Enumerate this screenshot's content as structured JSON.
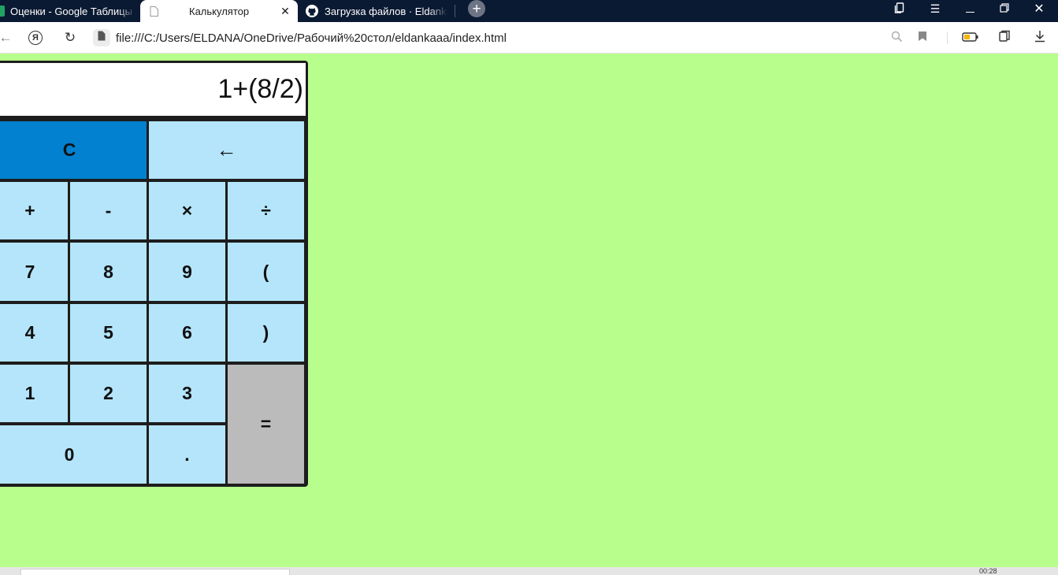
{
  "browser": {
    "tabs": [
      {
        "title": "Оценки - Google Таблицы",
        "icon": "google-sheets-icon",
        "active": false
      },
      {
        "title": "Калькулятор",
        "icon": "file-icon",
        "active": true
      },
      {
        "title": "Загрузка файлов · Eldanka",
        "icon": "github-icon",
        "active": false
      }
    ],
    "url": "file:///C:/Users/ELDANA/OneDrive/Рабочий%20стол/eldankaaa/index.html"
  },
  "calculator": {
    "display": "1+(8/2)",
    "keys": {
      "clear": "C",
      "backspace": "←",
      "plus": "+",
      "minus": "-",
      "multiply": "×",
      "divide": "÷",
      "seven": "7",
      "eight": "8",
      "nine": "9",
      "open_paren": "(",
      "four": "4",
      "five": "5",
      "six": "6",
      "close_paren": ")",
      "one": "1",
      "two": "2",
      "three": "3",
      "equals": "=",
      "zero": "0",
      "dot": "."
    }
  },
  "taskbar": {
    "clock": "00:28"
  },
  "colors": {
    "page_background": "#b8fe8d",
    "key": "#b4e5fb",
    "clear_key": "#0181cf",
    "equals_key": "#bbbbbb",
    "calculator_border": "#1d1d1d",
    "tab_strip": "#0b1a33"
  }
}
